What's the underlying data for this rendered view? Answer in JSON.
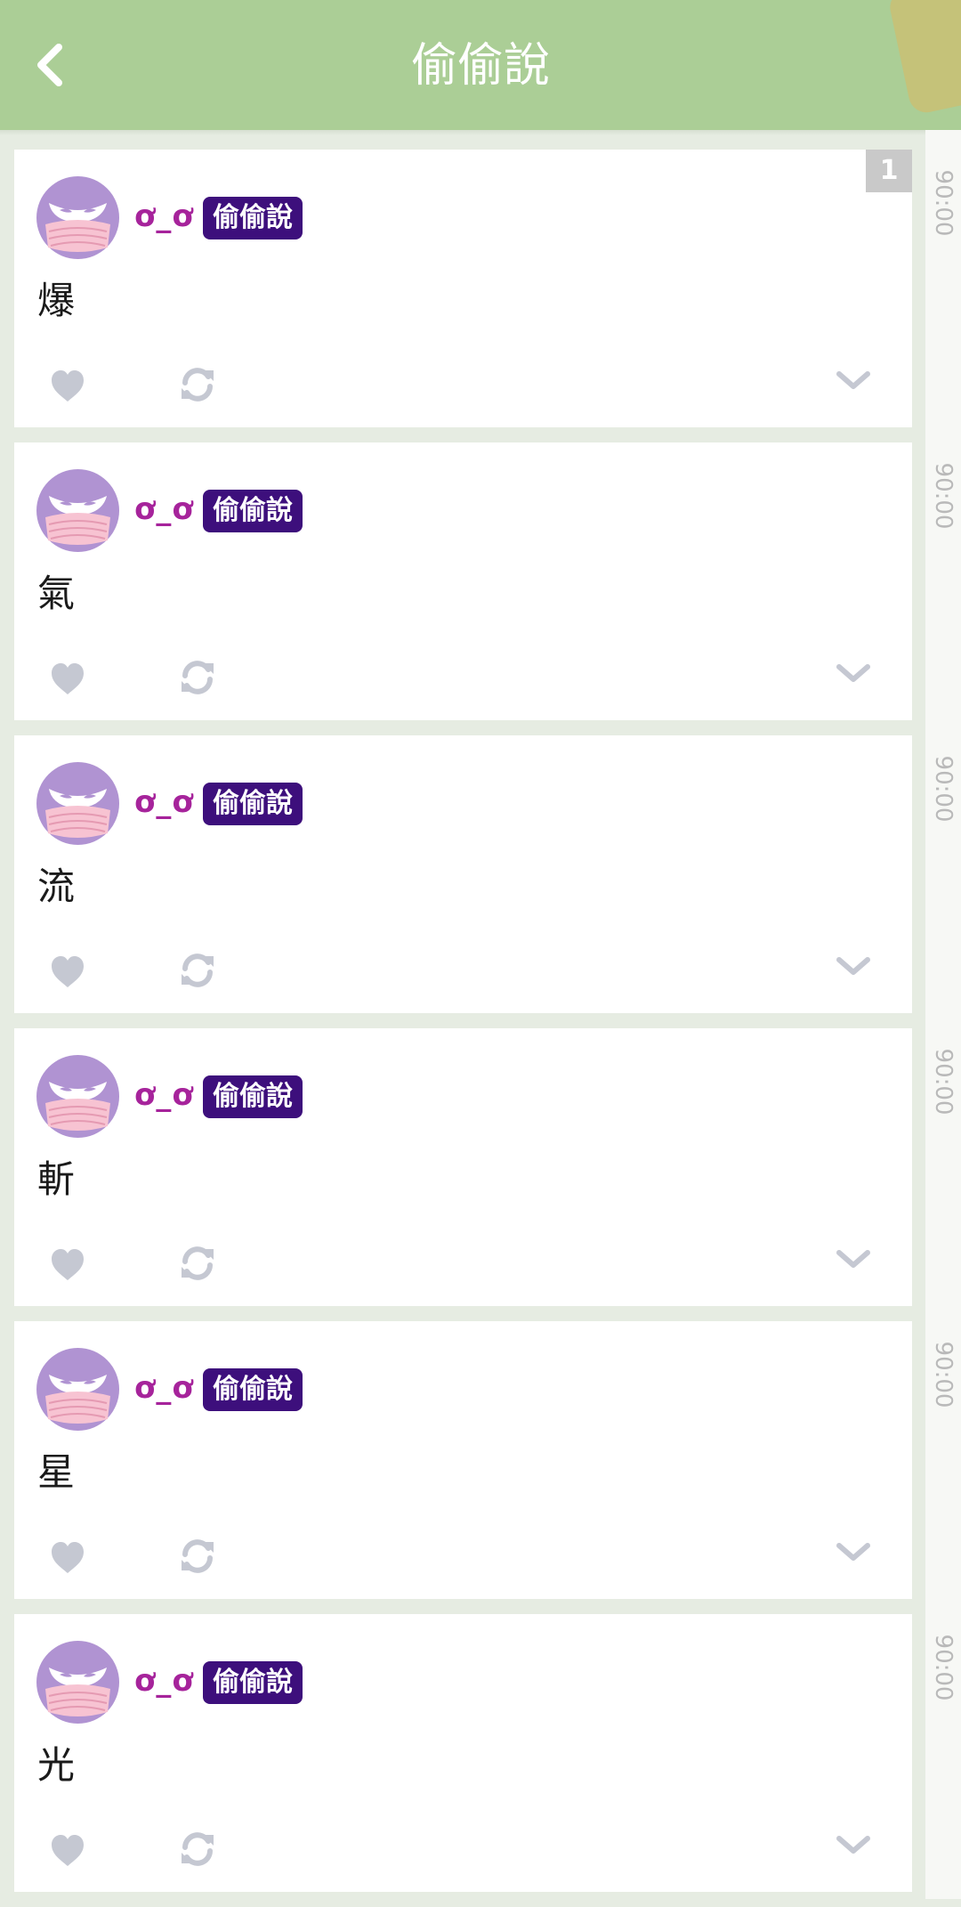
{
  "header": {
    "title": "偷偷說",
    "back_icon": "chevron-left-icon"
  },
  "colors": {
    "header_bg": "#abce96",
    "username": "#a6239b",
    "badge_bg": "#3d0f7c",
    "icon": "#c5c8d2"
  },
  "posts": [
    {
      "username": "ơ_ơ",
      "badge": "偷偷說",
      "content": "爆",
      "time": "90:00",
      "count": "1"
    },
    {
      "username": "ơ_ơ",
      "badge": "偷偷說",
      "content": "氣",
      "time": "90:00"
    },
    {
      "username": "ơ_ơ",
      "badge": "偷偷說",
      "content": "流",
      "time": "90:00"
    },
    {
      "username": "ơ_ơ",
      "badge": "偷偷說",
      "content": "斬",
      "time": "90:00"
    },
    {
      "username": "ơ_ơ",
      "badge": "偷偷說",
      "content": "星",
      "time": "90:00"
    },
    {
      "username": "ơ_ơ",
      "badge": "偷偷說",
      "content": "光",
      "time": "90:00"
    }
  ]
}
